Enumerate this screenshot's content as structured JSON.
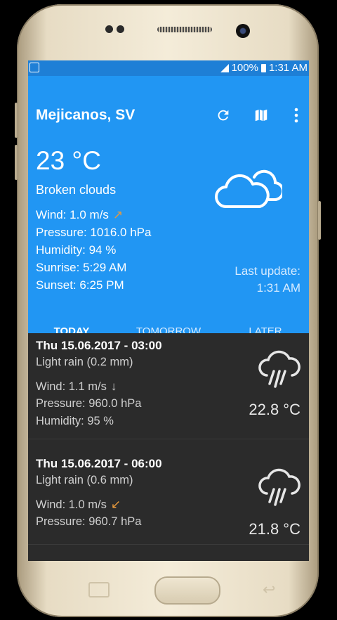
{
  "status_bar": {
    "battery": "100%",
    "time": "1:31 AM"
  },
  "app": {
    "location": "Mejicanos, SV",
    "refresh_icon": "refresh-icon",
    "map_icon": "map-icon",
    "menu_icon": "more-vert-icon"
  },
  "current": {
    "temperature": "23 °C",
    "description": "Broken clouds",
    "wind": "Wind: 1.0 m/s",
    "wind_arrow": "↗",
    "pressure": "Pressure: 1016.0 hPa",
    "humidity": "Humidity: 94 %",
    "sunrise": "Sunrise: 5:29 AM",
    "sunset": "Sunset: 6:25 PM",
    "last_update_label": "Last update:",
    "last_update_time": "1:31 AM",
    "icon": "broken-clouds-icon"
  },
  "tabs": [
    {
      "label": "TODAY",
      "active": true
    },
    {
      "label": "TOMORROW",
      "active": false
    },
    {
      "label": "LATER",
      "active": false
    }
  ],
  "forecast": [
    {
      "date": "Thu 15.06.2017 - 03:00",
      "description": "Light rain (0.2 mm)",
      "wind": "Wind: 1.1 m/s",
      "wind_arrow": "↓",
      "pressure": "Pressure: 960.0 hPa",
      "humidity": "Humidity: 95 %",
      "temperature": "22.8 °C",
      "icon": "rain-icon"
    },
    {
      "date": "Thu 15.06.2017 - 06:00",
      "description": "Light rain (0.6 mm)",
      "wind": "Wind: 1.0 m/s",
      "wind_arrow": "↙",
      "pressure": "Pressure: 960.7 hPa",
      "temperature": "21.8 °C",
      "icon": "rain-icon"
    }
  ],
  "colors": {
    "primary": "#2196f3",
    "status": "#1e7fd6",
    "list_bg": "#2b2b2b",
    "wind_arrow": "#e89a3c"
  }
}
